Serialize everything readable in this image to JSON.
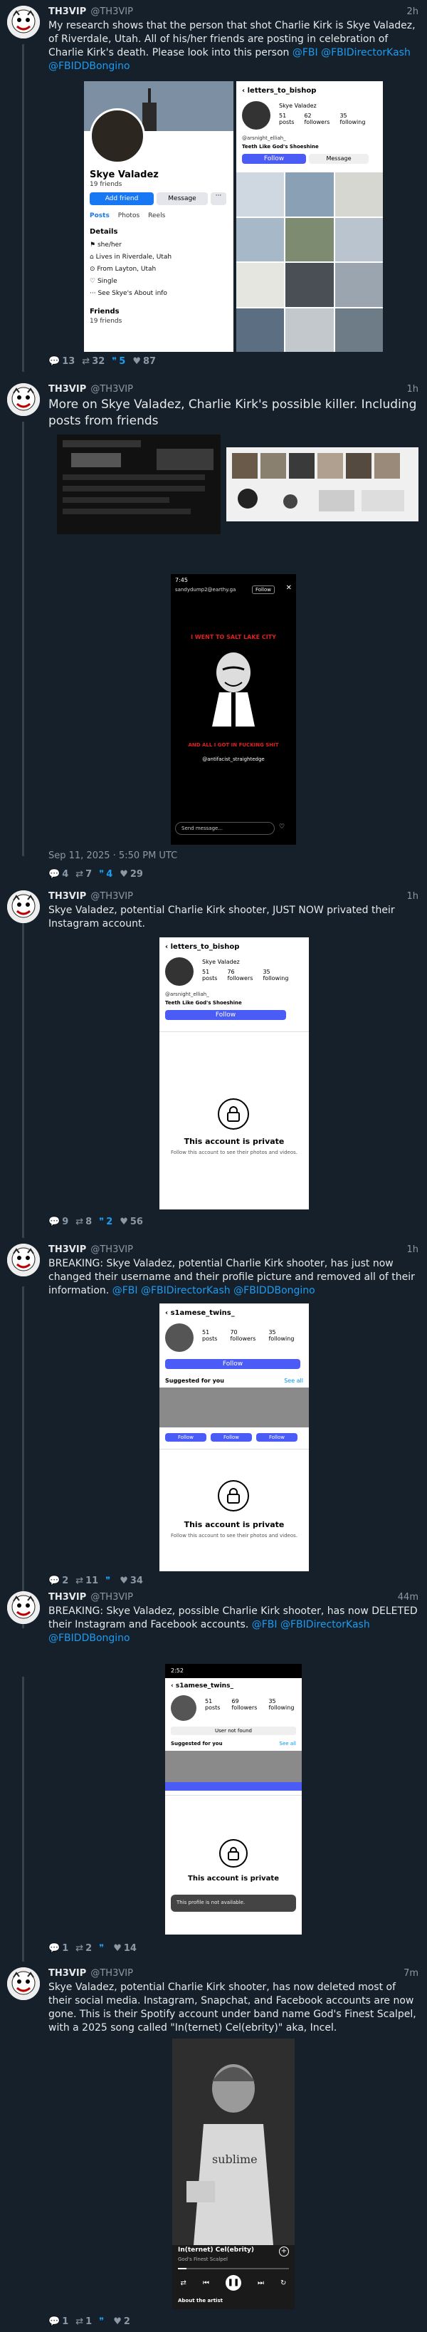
{
  "author": {
    "name": "TH3VIP",
    "handle": "@TH3VIP"
  },
  "tweets": [
    {
      "time": "2h",
      "text": "My research shows that the person that shot Charlie Kirk is Skye Valadez, of Riverdale, Utah. All of his/her friends are posting in celebration of Charlie Kirk's death. Please look into this person",
      "mentions": [
        "@FBI",
        "@FBIDirectorKash",
        "@FBIDDBongino"
      ],
      "replies": "13",
      "retweets": "32",
      "quotes": "5",
      "likes": "87",
      "media": {
        "left": {
          "name": "Skye Valadez",
          "friends": "19 friends",
          "add_friend": "Add friend",
          "message": "Message",
          "tabs": [
            "Posts",
            "Photos",
            "Reels"
          ],
          "details_title": "Details",
          "details": [
            "she/her",
            "Lives in Riverdale, Utah",
            "From Layton, Utah",
            "Single",
            "See Skye's About info"
          ],
          "friends_title": "Friends",
          "friends_count": "19 friends"
        },
        "right": {
          "username": "letters_to_bishop",
          "display": "Skye Valadez",
          "posts": "51",
          "followers": "62",
          "following": "35",
          "posts_label": "posts",
          "followers_label": "followers",
          "following_label": "following",
          "bio": "@arsnight_elliah_",
          "highlight": "Teeth Like God's Shoeshine",
          "follow": "Follow",
          "message": "Message"
        }
      }
    },
    {
      "time": "1h",
      "text": "More on Skye Valadez, Charlie Kirk's possible killer. Including posts from friends",
      "timestamp": "Sep 11, 2025 · 5:50 PM UTC",
      "replies": "4",
      "retweets": "7",
      "quotes": "4",
      "likes": "29",
      "story": {
        "time": "7:45",
        "user": "sandydump2@earthy.ga",
        "follow": "Follow",
        "line1": "I WENT TO SALT LAKE CITY",
        "line2": "AND ALL I GOT IN FUCKING SHIT",
        "tag": "@antifacist_straightedge",
        "send": "Send message..."
      }
    },
    {
      "time": "1h",
      "text": "Skye Valadez, potential Charlie Kirk shooter, JUST NOW privated their Instagram account.",
      "replies": "9",
      "retweets": "8",
      "quotes": "2",
      "likes": "56",
      "media": {
        "username": "letters_to_bishop",
        "display": "Skye Valadez",
        "posts": "51",
        "followers": "76",
        "following": "35",
        "posts_label": "posts",
        "followers_label": "followers",
        "following_label": "following",
        "bio": "@arsnight_elliah_",
        "highlight": "Teeth Like God's Shoeshine",
        "follow": "Follow",
        "private_title": "This account is private",
        "private_sub": "Follow this account to see their photos and videos."
      }
    },
    {
      "time": "1h",
      "text": "BREAKING: Skye Valadez, potential Charlie Kirk shooter, has just now changed their username and their profile picture and removed all of their information.",
      "mentions": [
        "@FBI",
        "@FBIDirectorKash",
        "@FBIDDBongino"
      ],
      "replies": "2",
      "retweets": "11",
      "quotes": "",
      "likes": "34",
      "media": {
        "username": "s1amese_twins_",
        "posts": "51",
        "followers": "70",
        "following": "35",
        "posts_label": "posts",
        "followers_label": "followers",
        "following_label": "following",
        "follow": "Follow",
        "suggested": "Suggested for you",
        "see_all": "See all",
        "private_title": "This account is private",
        "private_sub": "Follow this account to see their photos and videos."
      }
    },
    {
      "time": "44m",
      "text": "BREAKING: Skye Valadez, possible Charlie Kirk shooter, has now DELETED their Instagram and Facebook accounts.",
      "mentions": [
        "@FBI",
        "@FBIDirectorKash",
        "@FBIDDBongino"
      ],
      "replies": "1",
      "retweets": "2",
      "quotes": "",
      "likes": "14",
      "media": {
        "time": "2:52",
        "username": "s1amese_twins_",
        "posts": "51",
        "followers": "69",
        "following": "35",
        "posts_label": "posts",
        "followers_label": "followers",
        "following_label": "following",
        "not_found": "User not found",
        "suggested": "Suggested for you",
        "see_all": "See all",
        "private_title": "This account is private",
        "toast": "This profile is not available."
      }
    },
    {
      "time": "7m",
      "text": "Skye Valadez, potential Charlie Kirk shooter, has now deleted most of their social media. Instagram, Snapchat, and Facebook accounts are now gone. This is their Spotify account under band name God's Finest Scalpel, with a 2025 song called \"In(ternet) Cel(ebrity)\" aka, Incel.",
      "replies": "1",
      "retweets": "1",
      "quotes": "",
      "likes": "2",
      "media": {
        "song": "In(ternet) Cel(ebrity)",
        "artist": "God's Finest Scalpel",
        "shirt": "sublime",
        "about": "About the artist"
      }
    }
  ],
  "colors": {
    "bg": "#15202b",
    "text": "#e7e9ea",
    "muted": "#8b98a5",
    "link": "#1d9bf0"
  }
}
